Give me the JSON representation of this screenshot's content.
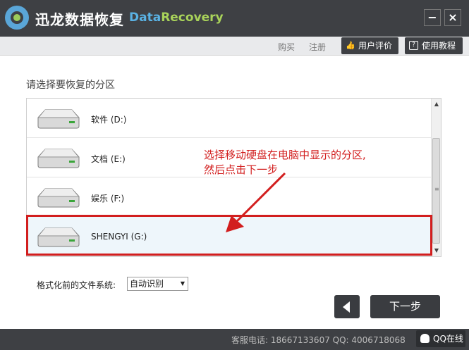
{
  "window": {
    "app_title": "迅龙数据恢复",
    "brand_part1": "Data",
    "brand_part2": "Recovery",
    "minimize": "−",
    "close": "×"
  },
  "toolbar": {
    "buy": "购买",
    "register": "注册",
    "review": "用户评价",
    "tutorial": "使用教程"
  },
  "main": {
    "heading": "请选择要恢复的分区",
    "partitions": [
      {
        "label": "软件 (D:)",
        "selected": false
      },
      {
        "label": "文档 (E:)",
        "selected": false
      },
      {
        "label": "娱乐 (F:)",
        "selected": false
      },
      {
        "label": "SHENGYI (G:)",
        "selected": true
      }
    ],
    "annotation_line1": "选择移动硬盘在电脑中显示的分区,",
    "annotation_line2": "然后点击下一步",
    "fs_label": "格式化前的文件系统:",
    "fs_value": "自动识别",
    "next": "下一步"
  },
  "footer": {
    "contact": "客服电话: 18667133607 QQ: 4006718068",
    "qq_online": "QQ在线"
  },
  "colors": {
    "titlebar": "#3e4044",
    "brand_data": "#5ab2e4",
    "brand_recovery": "#a9d35a",
    "highlight": "#d21e1e"
  },
  "icons": [
    "logo-icon",
    "thumbs-up-icon",
    "help-icon",
    "disk-icon",
    "back-arrow-icon",
    "qq-icon"
  ]
}
